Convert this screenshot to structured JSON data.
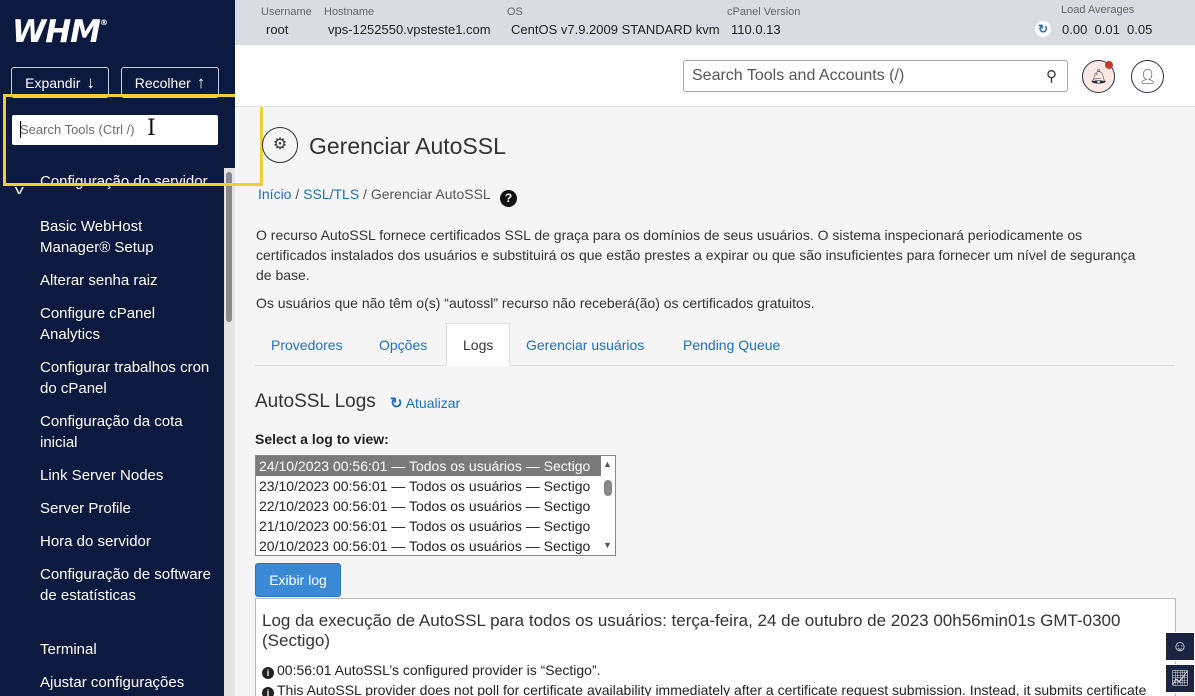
{
  "sidebar": {
    "logo": "WHM",
    "expand_label": "Expandir",
    "collapse_label": "Recolher",
    "search_placeholder": "Search Tools (Ctrl /)",
    "section_title": "Configuração do servidor",
    "items": [
      {
        "label": "Basic WebHost Manager® Setup"
      },
      {
        "label": "Alterar senha raiz"
      },
      {
        "label": "Configure cPanel Analytics"
      },
      {
        "label": "Configurar trabalhos cron do cPanel"
      },
      {
        "label": "Configuração da cota inicial"
      },
      {
        "label": "Link Server Nodes"
      },
      {
        "label": "Server Profile"
      },
      {
        "label": "Hora do servidor"
      },
      {
        "label": "Configuração de software de estatísticas"
      },
      {
        "label": "Terminal"
      },
      {
        "label": "Ajustar configurações"
      }
    ]
  },
  "topbar": {
    "username_label": "Username",
    "username": "root",
    "hostname_label": "Hostname",
    "hostname": "vps-1252550.vpsteste1.com",
    "os_label": "OS",
    "os": "CentOS v7.9.2009 STANDARD kvm",
    "cpanel_label": "cPanel Version",
    "cpanel_version": "110.0.13",
    "load_label": "Load Averages",
    "load_values": "0.00  0.01  0.05"
  },
  "header": {
    "search_placeholder": "Search Tools and Accounts (/)"
  },
  "page": {
    "title": "Gerenciar AutoSSL",
    "breadcrumb": {
      "home": "Início",
      "section": "SSL/TLS",
      "current": "Gerenciar AutoSSL"
    },
    "description": "O recurso AutoSSL fornece certificados SSL de graça para os domínios de seus usuários. O sistema inspecionará periodicamente os certificados instalados dos usuários e substituirá os que estão prestes a expirar ou que são insuficientes para fornecer um nível de segurança de base.",
    "description2": "Os usuários que não têm o(s) “autossl” recurso não receberá(ão) os certificados gratuitos.",
    "tabs": [
      {
        "label": "Provedores"
      },
      {
        "label": "Opções"
      },
      {
        "label": "Logs"
      },
      {
        "label": "Gerenciar usuários"
      },
      {
        "label": "Pending Queue"
      }
    ],
    "active_tab": "Logs",
    "logs_title": "AutoSSL Logs",
    "refresh_label": "Atualizar",
    "select_label": "Select a log to view:",
    "log_options": [
      "24/10/2023 00:56:01 — Todos os usuários — Sectigo",
      "23/10/2023 00:56:01 — Todos os usuários — Sectigo",
      "22/10/2023 00:56:01 — Todos os usuários — Sectigo",
      "21/10/2023 00:56:01 — Todos os usuários — Sectigo",
      "20/10/2023 00:56:01 — Todos os usuários — Sectigo"
    ],
    "show_log_label": "Exibir log",
    "log_header": "Log da execução de AutoSSL para todos os usuários: terça-feira, 24 de outubro de 2023 00h56min01s GMT-0300 (Sectigo)",
    "log_lines": [
      "00:56:01 AutoSSL’s configured provider is “Sectigo”.",
      "This AutoSSL provider does not poll for certificate availability immediately after a certificate request submission. Instead, it submits certificate requests then periodically polls the cPanel Store for each requested certificate and installs it after a successful retrieval. The"
    ]
  },
  "colors": {
    "sidebar_bg": "#0b1a3e",
    "accent": "#1f6fbf",
    "highlight_box": "#f0d030"
  }
}
